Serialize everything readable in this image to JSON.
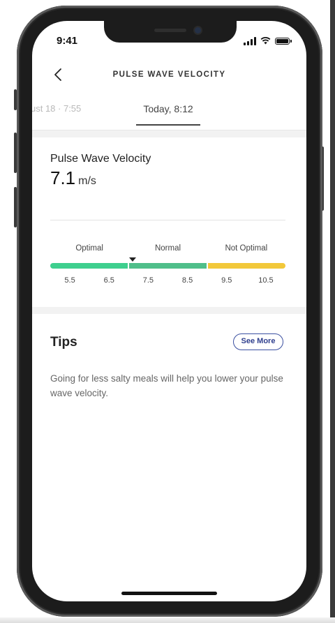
{
  "status_bar": {
    "time": "9:41"
  },
  "header": {
    "title": "PULSE WAVE VELOCITY"
  },
  "date_tabs": {
    "previous": "ust 18 · 7:55",
    "active": "Today, 8:12"
  },
  "measurement": {
    "label": "Pulse Wave Velocity",
    "value": "7.1",
    "unit": "m/s",
    "value_numeric": 7.1
  },
  "scale": {
    "min": 5.0,
    "max": 11.0,
    "zones": [
      {
        "label": "Optimal",
        "from": 5.0,
        "to": 7.0,
        "color": "#3ecf8e"
      },
      {
        "label": "Normal",
        "from": 7.0,
        "to": 9.0,
        "color": "#4fbf8a"
      },
      {
        "label": "Not Optimal",
        "from": 9.0,
        "to": 11.0,
        "color": "#f2c83a"
      }
    ],
    "ticks": [
      "5.5",
      "6.5",
      "7.5",
      "8.5",
      "9.5",
      "10.5"
    ]
  },
  "tips": {
    "title": "Tips",
    "see_more": "See More",
    "text": "Going for less salty meals will help you lower your pulse wave velocity."
  },
  "colors": {
    "accent": "#2f3f8e",
    "text": "#222222",
    "muted": "#666666"
  }
}
